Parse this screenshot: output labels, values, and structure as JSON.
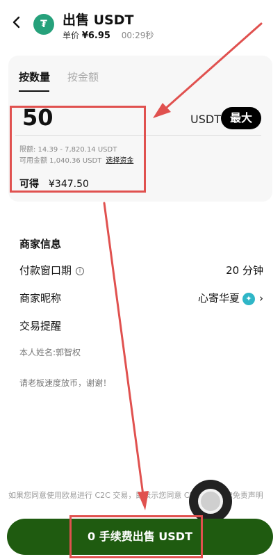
{
  "header": {
    "title": "出售 USDT",
    "price_label": "单价",
    "price_value": "¥6.95",
    "timer": "00:29秒",
    "coin_symbol": "₮"
  },
  "tabs": [
    {
      "label": "按数量",
      "active": true
    },
    {
      "label": "按金额",
      "active": false
    }
  ],
  "input": {
    "amount": "50",
    "unit": "USDT",
    "max_label": "最大"
  },
  "limits": {
    "range_text": "限额: 14.39 - 7,820.14 USDT",
    "available_text": "可用金额 1,040.36 USDT",
    "select_funds_label": "选择资金"
  },
  "receive": {
    "label": "可得",
    "value": "¥347.50"
  },
  "merchant": {
    "section_title": "商家信息",
    "payment_window_label": "付款窗口期",
    "payment_window_value": "20 分钟",
    "nickname_label": "商家昵称",
    "nickname_value": "心寄华夏",
    "reminder_label": "交易提醒",
    "real_name_note": "本人姓名:郭智权",
    "message_note": "请老板速度放币，谢谢！"
  },
  "disclaimer": "如果您同意使用欧易进行 C2C 交易，即表示您同意 C2C 交易法律免责声明",
  "action": {
    "sell_label": "0 手续费出售 USDT"
  },
  "colors": {
    "brand_green": "#1f5b10",
    "annotation_red": "#e0514f",
    "tether_green": "#26a17b"
  }
}
